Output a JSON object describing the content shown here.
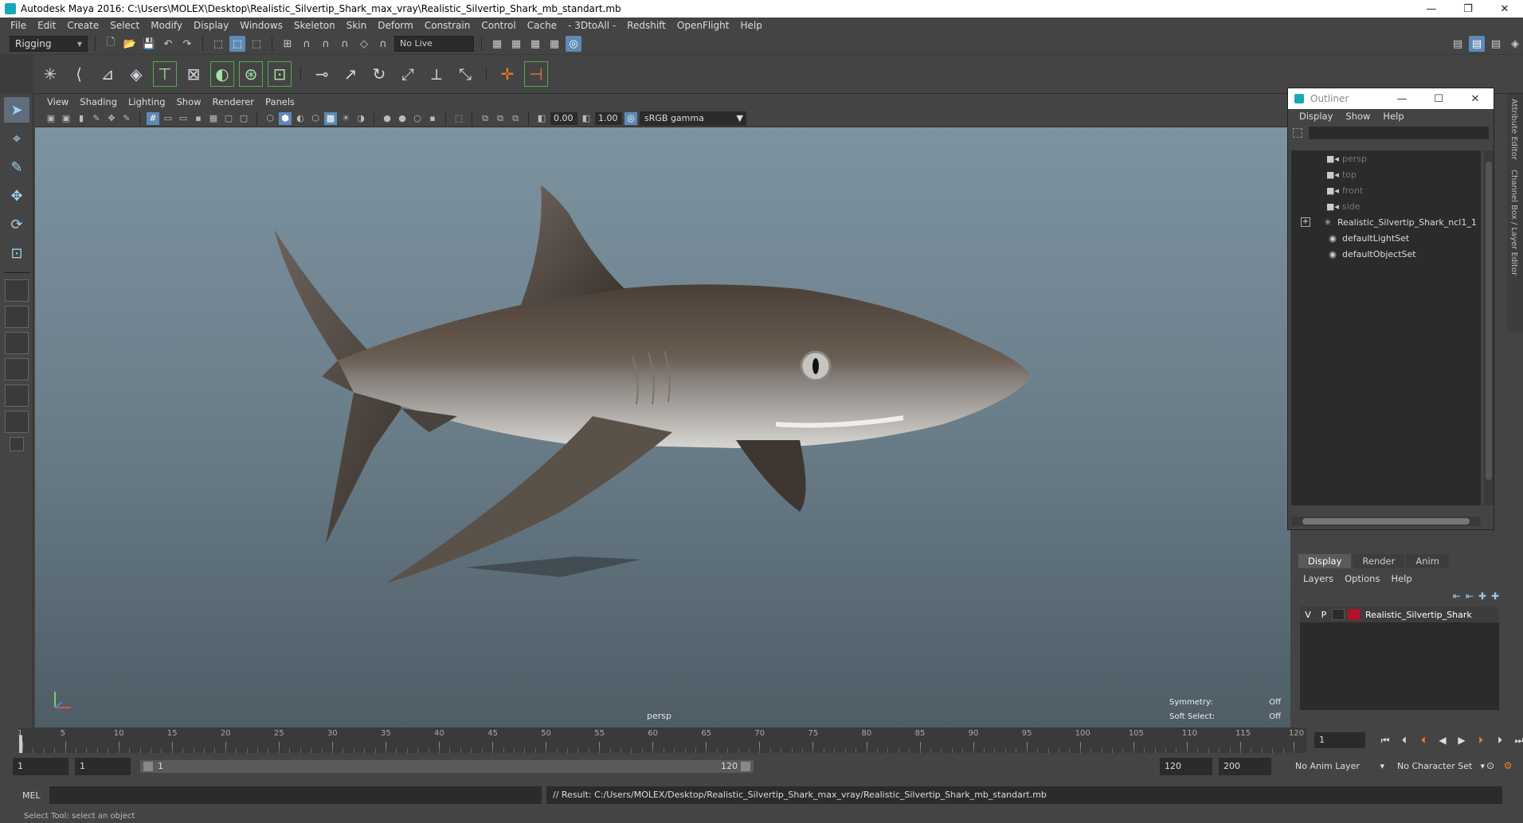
{
  "window": {
    "title": "Autodesk Maya 2016: C:\\Users\\MOLEX\\Desktop\\Realistic_Silvertip_Shark_max_vray\\Realistic_Silvertip_Shark_mb_standart.mb",
    "minimize": "—",
    "restore": "❐",
    "close": "✕"
  },
  "menubar": [
    "File",
    "Edit",
    "Create",
    "Select",
    "Modify",
    "Display",
    "Windows",
    "Skeleton",
    "Skin",
    "Deform",
    "Constrain",
    "Control",
    "Cache",
    "- 3DtoAll -",
    "Redshift",
    "OpenFlight",
    "Help"
  ],
  "statusline": {
    "mode": "Rigging",
    "live_surface": "No Live Surface"
  },
  "panel_menu": [
    "View",
    "Shading",
    "Lighting",
    "Show",
    "Renderer",
    "Panels"
  ],
  "panel_toolbar": {
    "exposure": "0.00",
    "gamma_value": "1.00",
    "color_space": "sRGB gamma"
  },
  "viewport": {
    "camera": "persp",
    "symmetry_label": "Symmetry:",
    "symmetry_value": "Off",
    "soft_select_label": "Soft Select:",
    "soft_select_value": "Off"
  },
  "outliner": {
    "title": "Outliner",
    "menu": [
      "Display",
      "Show",
      "Help"
    ],
    "items": [
      {
        "label": "persp",
        "icon": "camera-icon",
        "dim": true
      },
      {
        "label": "top",
        "icon": "camera-icon",
        "dim": true
      },
      {
        "label": "front",
        "icon": "camera-icon",
        "dim": true
      },
      {
        "label": "side",
        "icon": "camera-icon",
        "dim": true
      },
      {
        "label": "Realistic_Silvertip_Shark_ncl1_1",
        "icon": "joint-icon",
        "dim": false,
        "expandable": true
      },
      {
        "label": "defaultLightSet",
        "icon": "set-icon",
        "dim": false
      },
      {
        "label": "defaultObjectSet",
        "icon": "set-icon",
        "dim": false
      }
    ]
  },
  "side_tabs": [
    "Attribute Editor",
    "Channel Box / Layer Editor"
  ],
  "layers": {
    "tabs": [
      "Display",
      "Render",
      "Anim"
    ],
    "menu": [
      "Layers",
      "Options",
      "Help"
    ],
    "rows": [
      {
        "v": "V",
        "p": "P",
        "name": "Realistic_Silvertip_Shark",
        "color": "#b0122a"
      }
    ]
  },
  "timeslider": {
    "ticks": [
      "1",
      "5",
      "10",
      "15",
      "20",
      "25",
      "30",
      "35",
      "40",
      "45",
      "50",
      "55",
      "60",
      "65",
      "70",
      "75",
      "80",
      "85",
      "90",
      "95",
      "100",
      "105",
      "110",
      "115",
      "120"
    ],
    "current_frame": "1"
  },
  "rangeslider": {
    "start": "1",
    "playback_start": "1",
    "range_start_label": "1",
    "range_end_label": "120",
    "playback_end": "120",
    "end": "200",
    "anim_layer": "No Anim Layer",
    "character_set": "No Character Set"
  },
  "cmdline": {
    "label": "MEL",
    "result": "// Result: C:/Users/MOLEX/Desktop/Realistic_Silvertip_Shark_max_vray/Realistic_Silvertip_Shark_mb_standart.mb"
  },
  "helpline": "Select Tool: select an object"
}
